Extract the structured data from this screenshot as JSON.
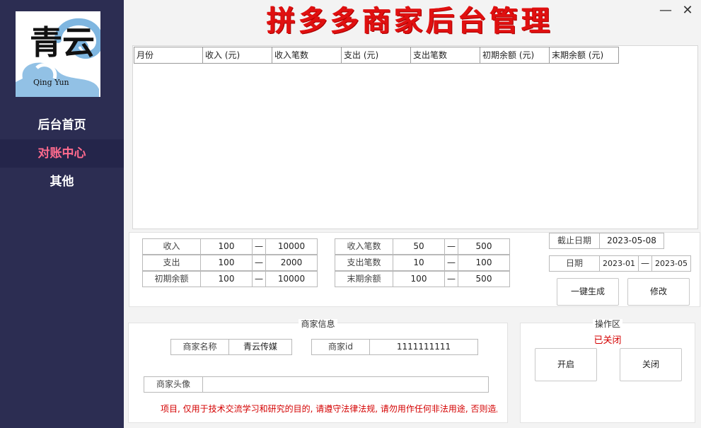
{
  "app": {
    "title": "拼多多商家后台管理",
    "logo_text": "青云",
    "logo_subtext": "Qing Yun"
  },
  "sidebar": {
    "items": [
      {
        "label": "后台首页"
      },
      {
        "label": "对账中心"
      },
      {
        "label": "其他"
      }
    ]
  },
  "table": {
    "columns": [
      "月份",
      "收入 (元)",
      "收入笔数",
      "支出 (元)",
      "支出笔数",
      "初期余额 (元)",
      "末期余额 (元)"
    ]
  },
  "filters": {
    "left": [
      {
        "label": "收入",
        "min": "100",
        "sep": "—",
        "max": "10000"
      },
      {
        "label": "支出",
        "min": "100",
        "sep": "—",
        "max": "2000"
      },
      {
        "label": "初期余额",
        "min": "100",
        "sep": "—",
        "max": "10000"
      }
    ],
    "right": [
      {
        "label": "收入笔数",
        "min": "50",
        "sep": "—",
        "max": "500"
      },
      {
        "label": "支出笔数",
        "min": "10",
        "sep": "—",
        "max": "100"
      },
      {
        "label": "末期余额",
        "min": "100",
        "sep": "—",
        "max": "500"
      }
    ],
    "cutoff_label": "截止日期",
    "cutoff_value": "2023-05-08",
    "date_label": "日期",
    "date_from": "2023-01",
    "date_sep": "—",
    "date_to": "2023-05",
    "generate_button": "一键生成",
    "modify_button": "修改"
  },
  "merchant": {
    "group_title": "商家信息",
    "name_label": "商家名称",
    "name_value": "青云传媒",
    "id_label": "商家id",
    "id_value": "1111111111",
    "avatar_label": "商家头像",
    "avatar_value": ""
  },
  "operation": {
    "group_title": "操作区",
    "status": "已关闭",
    "open_button": "开启",
    "close_button": "关闭"
  },
  "notice": "项目, 仅用于技术交流学习和研究的目的, 请遵守法律法规, 请勿用作任何非法用途, 否则造成",
  "window": {
    "minimize": "—",
    "close": "✕"
  },
  "colors": {
    "sidebar_bg": "#2c2d52",
    "active_text": "#ff6b8e",
    "title_red": "#e01010",
    "warning_red": "#d40000"
  }
}
